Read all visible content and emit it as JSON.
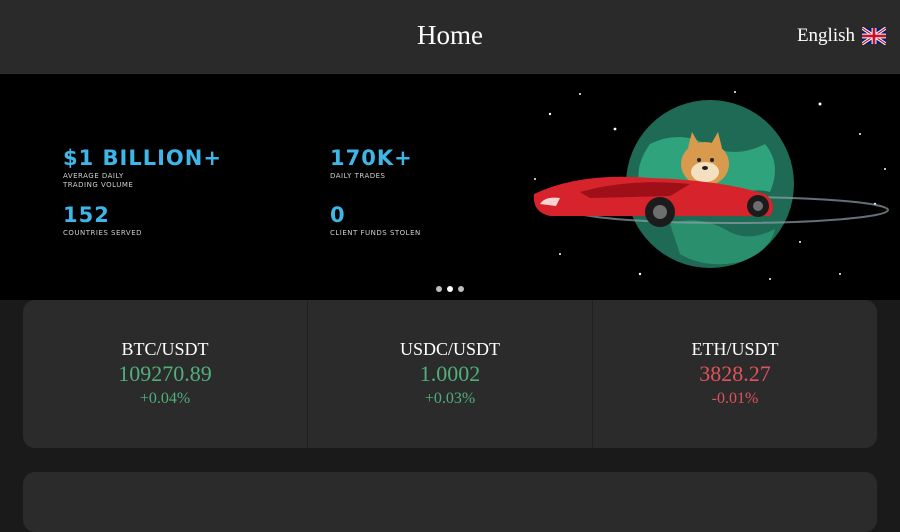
{
  "header": {
    "title": "Home",
    "language": "English"
  },
  "banner": {
    "stats": [
      {
        "value": "$1 BILLION+",
        "label": "AVERAGE DAILY\nTRADING VOLUME"
      },
      {
        "value": "170K+",
        "label": "DAILY TRADES"
      },
      {
        "value": "152",
        "label": "COUNTRIES SERVED"
      },
      {
        "value": "0",
        "label": "CLIENT FUNDS STOLEN"
      }
    ],
    "slides_count": 3,
    "active_slide": 1,
    "stat_color": "#3fb6e8"
  },
  "tickers": [
    {
      "pair": "BTC/USDT",
      "price": "109270.89",
      "change": "+0.04%",
      "trend": "up"
    },
    {
      "pair": "USDC/USDT",
      "price": "1.0002",
      "change": "+0.03%",
      "trend": "up"
    },
    {
      "pair": "ETH/USDT",
      "price": "3828.27",
      "change": "-0.01%",
      "trend": "down"
    }
  ],
  "colors": {
    "up": "#4fb07a",
    "down": "#e0525c",
    "header_bg": "#2a2a2a",
    "card_bg": "#2b2b2b",
    "page_bg": "#1a1a1a"
  }
}
